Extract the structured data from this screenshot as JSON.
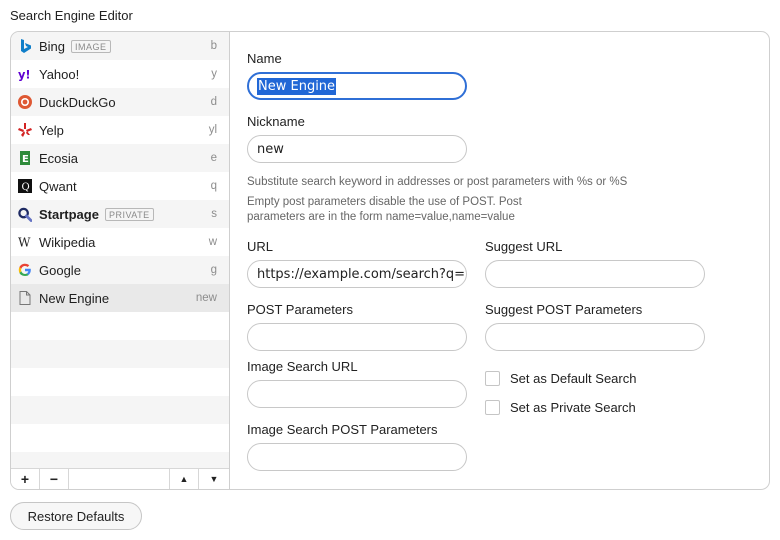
{
  "window": {
    "title": "Search Engine Editor"
  },
  "engines": [
    {
      "name": "Bing",
      "keyword": "b",
      "badge": "IMAGE",
      "icon": "bing-icon",
      "color": "#0f7ec9",
      "bold": false
    },
    {
      "name": "Yahoo!",
      "keyword": "y",
      "badge": "",
      "icon": "yahoo-icon",
      "color": "#6001d2",
      "bold": false
    },
    {
      "name": "DuckDuckGo",
      "keyword": "d",
      "badge": "",
      "icon": "duckduckgo-icon",
      "color": "#de5833",
      "bold": false
    },
    {
      "name": "Yelp",
      "keyword": "yl",
      "badge": "",
      "icon": "yelp-icon",
      "color": "#d32323",
      "bold": false
    },
    {
      "name": "Ecosia",
      "keyword": "e",
      "badge": "",
      "icon": "ecosia-icon",
      "color": "#2e8b3a",
      "bold": false
    },
    {
      "name": "Qwant",
      "keyword": "q",
      "badge": "",
      "icon": "qwant-icon",
      "color": "#111111",
      "bold": false
    },
    {
      "name": "Startpage",
      "keyword": "s",
      "badge": "PRIVATE",
      "icon": "startpage-icon",
      "color": "#1e2a63",
      "bold": true
    },
    {
      "name": "Wikipedia",
      "keyword": "w",
      "badge": "",
      "icon": "wikipedia-icon",
      "color": "#222222",
      "bold": false
    },
    {
      "name": "Google",
      "keyword": "g",
      "badge": "",
      "icon": "google-icon",
      "color": "#4285f4",
      "bold": false
    },
    {
      "name": "New Engine",
      "keyword": "new",
      "badge": "",
      "icon": "document-icon",
      "color": "#777777",
      "bold": false,
      "selected": true
    }
  ],
  "list_controls": {
    "add": "+",
    "remove": "−",
    "up": "▲",
    "down": "▼"
  },
  "form": {
    "name_label": "Name",
    "name_value": "New Engine",
    "nickname_label": "Nickname",
    "nickname_value": "new",
    "hint_keyword": "Substitute search keyword in addresses or post parameters with %s or %S",
    "hint_post": "Empty post parameters disable the use of POST. Post parameters are in the form name=value,name=value",
    "url_label": "URL",
    "url_value": "https://example.com/search?q=%s",
    "suggest_url_label": "Suggest URL",
    "suggest_url_value": "",
    "post_label": "POST Parameters",
    "post_value": "",
    "suggest_post_label": "Suggest POST Parameters",
    "suggest_post_value": "",
    "image_url_label": "Image Search URL",
    "image_url_value": "",
    "image_post_label": "Image Search POST Parameters",
    "image_post_value": "",
    "default_search_label": "Set as Default Search",
    "default_search_checked": false,
    "private_search_label": "Set as Private Search",
    "private_search_checked": false
  },
  "footer": {
    "restore_label": "Restore Defaults"
  },
  "colors": {
    "focus": "#2f6fd6",
    "selection": "#2167d6"
  }
}
